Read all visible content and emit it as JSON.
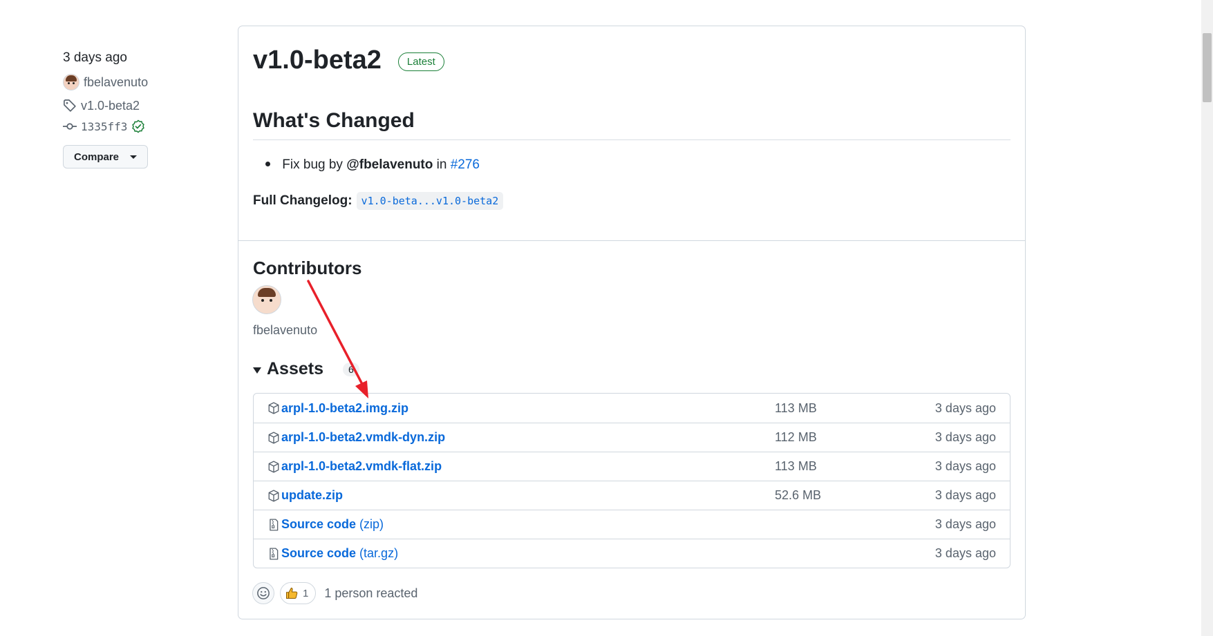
{
  "meta": {
    "date": "3 days ago",
    "author": "fbelavenuto",
    "tag": "v1.0-beta2",
    "commit": "1335ff3",
    "compare_label": "Compare"
  },
  "release": {
    "title": "v1.0-beta2",
    "badge": "Latest",
    "whats_changed": "What's Changed",
    "change_item": {
      "prefix": "Fix bug by",
      "user": "@fbelavenuto",
      "in": "in",
      "pr": "#276"
    },
    "changelog_label": "Full Changelog:",
    "changelog_link": "v1.0-beta...v1.0-beta2"
  },
  "contributors": {
    "title": "Contributors",
    "name": "fbelavenuto"
  },
  "assets": {
    "title": "Assets",
    "count": "6",
    "rows": [
      {
        "name": "arpl-1.0-beta2.img.zip",
        "suffix": "",
        "size": "113 MB",
        "date": "3 days ago",
        "icon": "package-icon"
      },
      {
        "name": "arpl-1.0-beta2.vmdk-dyn.zip",
        "suffix": "",
        "size": "112 MB",
        "date": "3 days ago",
        "icon": "package-icon"
      },
      {
        "name": "arpl-1.0-beta2.vmdk-flat.zip",
        "suffix": "",
        "size": "113 MB",
        "date": "3 days ago",
        "icon": "package-icon"
      },
      {
        "name": "update.zip",
        "suffix": "",
        "size": "52.6 MB",
        "date": "3 days ago",
        "icon": "package-icon"
      },
      {
        "name": "Source code",
        "suffix": "(zip)",
        "size": "",
        "date": "3 days ago",
        "icon": "file-zip-icon"
      },
      {
        "name": "Source code",
        "suffix": "(tar.gz)",
        "size": "",
        "date": "3 days ago",
        "icon": "file-zip-icon"
      }
    ]
  },
  "reactions": {
    "thumbs_count": "1",
    "summary": "1 person reacted"
  },
  "colors": {
    "link": "#0969da",
    "latest_badge": "#1a7f37",
    "annotation_arrow": "#e8202a"
  }
}
